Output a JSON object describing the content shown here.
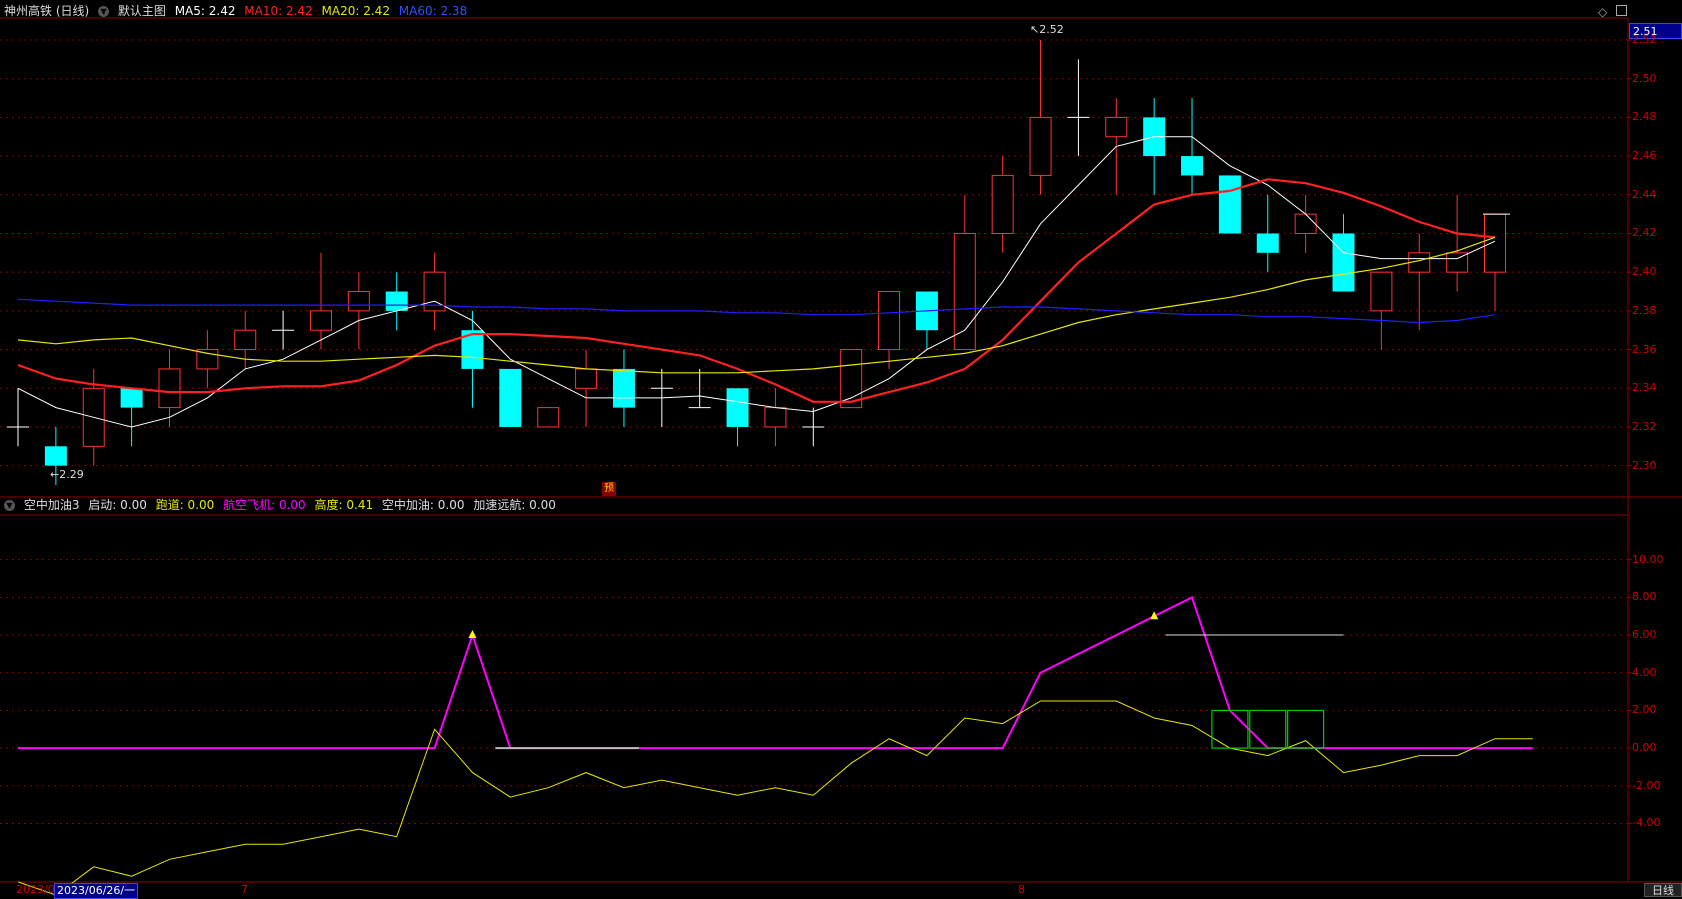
{
  "colors": {
    "up": "#ff3232",
    "down": "#00ffff",
    "ma5": "#ffffff",
    "ma10": "#ff2020",
    "ma20": "#e6e600",
    "ma60": "#2020ff",
    "gridRed": "#8b0000",
    "magenta": "#ff00ff",
    "yellowLine": "#e6e600",
    "green": "#00cc00"
  },
  "header": {
    "title": "神州高铁 (日线)",
    "menu": "默认主图",
    "ma5": "MA5: 2.42",
    "ma10": "MA10: 2.42",
    "ma20": "MA20: 2.42",
    "ma60": "MA60: 2.38"
  },
  "header2": {
    "name": "空中加油3",
    "qidong": "启动: 0.00",
    "paodao": "跑道: 0.00",
    "hangkong": "航空飞机: 0.00",
    "gaodu": "高度: 0.41",
    "kongzhong": "空中加油: 0.00",
    "jiasu": "加速远航: 0.00"
  },
  "price_box": "2.51",
  "annotations": {
    "high": "2.52",
    "low": "←2.29",
    "yu": "预"
  },
  "dates": {
    "d1": "2023/06",
    "d2": "2023/06/26/一",
    "d3": "7",
    "d4": "8"
  },
  "tab": "日线",
  "chart_data": [
    {
      "type": "candlestick",
      "title": "神州高铁 (日线)",
      "ylim": [
        2.29,
        2.52
      ],
      "y_ticks": [
        "2.52",
        "2.50",
        "2.48",
        "2.46",
        "2.44",
        "2.42",
        "2.40",
        "2.38",
        "2.36",
        "2.34",
        "2.32",
        "2.30"
      ],
      "candles": [
        {
          "o": 2.32,
          "h": 2.34,
          "l": 2.31,
          "c": 2.32
        },
        {
          "o": 2.31,
          "h": 2.32,
          "l": 2.29,
          "c": 2.3
        },
        {
          "o": 2.31,
          "h": 2.35,
          "l": 2.3,
          "c": 2.34
        },
        {
          "o": 2.34,
          "h": 2.34,
          "l": 2.31,
          "c": 2.33
        },
        {
          "o": 2.33,
          "h": 2.36,
          "l": 2.32,
          "c": 2.35
        },
        {
          "o": 2.35,
          "h": 2.37,
          "l": 2.34,
          "c": 2.36
        },
        {
          "o": 2.36,
          "h": 2.38,
          "l": 2.35,
          "c": 2.37
        },
        {
          "o": 2.37,
          "h": 2.38,
          "l": 2.36,
          "c": 2.37
        },
        {
          "o": 2.37,
          "h": 2.41,
          "l": 2.36,
          "c": 2.38
        },
        {
          "o": 2.38,
          "h": 2.4,
          "l": 2.36,
          "c": 2.39
        },
        {
          "o": 2.39,
          "h": 2.4,
          "l": 2.37,
          "c": 2.38
        },
        {
          "o": 2.38,
          "h": 2.41,
          "l": 2.37,
          "c": 2.4
        },
        {
          "o": 2.37,
          "h": 2.38,
          "l": 2.33,
          "c": 2.35
        },
        {
          "o": 2.35,
          "h": 2.35,
          "l": 2.32,
          "c": 2.32
        },
        {
          "o": 2.32,
          "h": 2.33,
          "l": 2.32,
          "c": 2.33
        },
        {
          "o": 2.34,
          "h": 2.36,
          "l": 2.32,
          "c": 2.35
        },
        {
          "o": 2.35,
          "h": 2.36,
          "l": 2.32,
          "c": 2.33
        },
        {
          "o": 2.34,
          "h": 2.35,
          "l": 2.32,
          "c": 2.34
        },
        {
          "o": 2.33,
          "h": 2.35,
          "l": 2.33,
          "c": 2.33
        },
        {
          "o": 2.34,
          "h": 2.34,
          "l": 2.31,
          "c": 2.32
        },
        {
          "o": 2.32,
          "h": 2.34,
          "l": 2.31,
          "c": 2.33
        },
        {
          "o": 2.32,
          "h": 2.33,
          "l": 2.31,
          "c": 2.32
        },
        {
          "o": 2.33,
          "h": 2.36,
          "l": 2.33,
          "c": 2.36
        },
        {
          "o": 2.36,
          "h": 2.39,
          "l": 2.35,
          "c": 2.39
        },
        {
          "o": 2.39,
          "h": 2.39,
          "l": 2.36,
          "c": 2.37
        },
        {
          "o": 2.36,
          "h": 2.44,
          "l": 2.36,
          "c": 2.42
        },
        {
          "o": 2.42,
          "h": 2.46,
          "l": 2.41,
          "c": 2.45
        },
        {
          "o": 2.45,
          "h": 2.52,
          "l": 2.44,
          "c": 2.48
        },
        {
          "o": 2.48,
          "h": 2.51,
          "l": 2.46,
          "c": 2.48
        },
        {
          "o": 2.47,
          "h": 2.49,
          "l": 2.44,
          "c": 2.48
        },
        {
          "o": 2.48,
          "h": 2.49,
          "l": 2.44,
          "c": 2.46
        },
        {
          "o": 2.46,
          "h": 2.49,
          "l": 2.44,
          "c": 2.45
        },
        {
          "o": 2.45,
          "h": 2.45,
          "l": 2.42,
          "c": 2.42
        },
        {
          "o": 2.42,
          "h": 2.44,
          "l": 2.4,
          "c": 2.41
        },
        {
          "o": 2.42,
          "h": 2.44,
          "l": 2.41,
          "c": 2.43
        },
        {
          "o": 2.42,
          "h": 2.43,
          "l": 2.39,
          "c": 2.39
        },
        {
          "o": 2.38,
          "h": 2.4,
          "l": 2.36,
          "c": 2.4
        },
        {
          "o": 2.4,
          "h": 2.42,
          "l": 2.37,
          "c": 2.41
        },
        {
          "o": 2.4,
          "h": 2.44,
          "l": 2.39,
          "c": 2.41
        },
        {
          "o": 2.4,
          "h": 2.43,
          "l": 2.38,
          "c": 2.43
        }
      ],
      "series": [
        {
          "name": "MA5",
          "values": [
            2.34,
            2.33,
            2.325,
            2.32,
            2.325,
            2.335,
            2.35,
            2.355,
            2.365,
            2.375,
            2.38,
            2.385,
            2.375,
            2.355,
            2.345,
            2.335,
            2.335,
            2.335,
            2.336,
            2.333,
            2.33,
            2.328,
            2.335,
            2.345,
            2.36,
            2.37,
            2.395,
            2.425,
            2.445,
            2.465,
            2.47,
            2.47,
            2.455,
            2.445,
            2.43,
            2.41,
            2.407,
            2.407,
            2.407,
            2.416
          ]
        },
        {
          "name": "MA10",
          "values": [
            2.352,
            2.345,
            2.342,
            2.34,
            2.338,
            2.338,
            2.34,
            2.341,
            2.341,
            2.344,
            2.352,
            2.362,
            2.368,
            2.368,
            2.367,
            2.366,
            2.363,
            2.36,
            2.357,
            2.35,
            2.342,
            2.333,
            2.333,
            2.338,
            2.343,
            2.35,
            2.365,
            2.385,
            2.405,
            2.42,
            2.435,
            2.44,
            2.442,
            2.448,
            2.446,
            2.441,
            2.434,
            2.426,
            2.42,
            2.418
          ]
        },
        {
          "name": "MA20",
          "values": [
            2.365,
            2.363,
            2.365,
            2.366,
            2.362,
            2.358,
            2.355,
            2.354,
            2.354,
            2.355,
            2.356,
            2.357,
            2.356,
            2.354,
            2.352,
            2.35,
            2.349,
            2.348,
            2.348,
            2.348,
            2.349,
            2.35,
            2.352,
            2.354,
            2.356,
            2.358,
            2.362,
            2.368,
            2.374,
            2.378,
            2.381,
            2.384,
            2.387,
            2.391,
            2.396,
            2.399,
            2.402,
            2.406,
            2.411,
            2.418
          ]
        },
        {
          "name": "MA60",
          "values": [
            2.386,
            2.385,
            2.384,
            2.383,
            2.383,
            2.383,
            2.383,
            2.383,
            2.383,
            2.383,
            2.383,
            2.383,
            2.382,
            2.382,
            2.381,
            2.381,
            2.38,
            2.38,
            2.38,
            2.379,
            2.379,
            2.378,
            2.378,
            2.379,
            2.38,
            2.381,
            2.382,
            2.382,
            2.381,
            2.38,
            2.379,
            2.378,
            2.378,
            2.377,
            2.377,
            2.376,
            2.375,
            2.374,
            2.375,
            2.378
          ]
        }
      ]
    },
    {
      "type": "line",
      "title": "空中加油3",
      "ylim": [
        -7,
        12
      ],
      "y_ticks": [
        "10.00",
        "8.00",
        "6.00",
        "4.00",
        "2.00",
        "0.00",
        "-2.00",
        "-4.00"
      ],
      "series": [
        {
          "name": "航空飞机",
          "values": [
            0,
            0,
            0,
            0,
            0,
            0,
            0,
            0,
            0,
            0,
            0,
            0,
            6,
            0,
            0,
            0,
            0,
            0,
            0,
            0,
            0,
            0,
            0,
            0,
            0,
            0,
            0,
            4,
            5,
            6,
            7,
            8,
            2,
            0,
            0,
            0,
            0,
            0,
            0,
            0,
            0
          ]
        },
        {
          "name": "高度",
          "values": [
            -7.1,
            -7.8,
            -6.3,
            -6.8,
            -5.9,
            -5.5,
            -5.1,
            -5.1,
            -4.7,
            -4.3,
            -4.7,
            1,
            -1.3,
            -2.6,
            -2.1,
            -1.3,
            -2.1,
            -1.7,
            -2.1,
            -2.5,
            -2.1,
            -2.5,
            -0.8,
            0.5,
            -0.4,
            1.6,
            1.3,
            2.5,
            2.5,
            2.5,
            1.6,
            1.2,
            0,
            -0.4,
            0.4,
            -1.3,
            -0.9,
            -0.4,
            -0.4,
            0.5,
            0.5
          ]
        }
      ],
      "markers": [
        {
          "type": "triangle",
          "x": 12,
          "y": 6
        },
        {
          "type": "triangle",
          "x": 30,
          "y": 7
        }
      ],
      "hline": {
        "x_start": 30.3,
        "x_end": 35,
        "y": 6
      },
      "boxes": [
        {
          "x": 32,
          "y": 0,
          "h": 2
        },
        {
          "x": 33,
          "y": 0,
          "h": 2
        },
        {
          "x": 34,
          "y": 0,
          "h": 2
        }
      ]
    }
  ]
}
